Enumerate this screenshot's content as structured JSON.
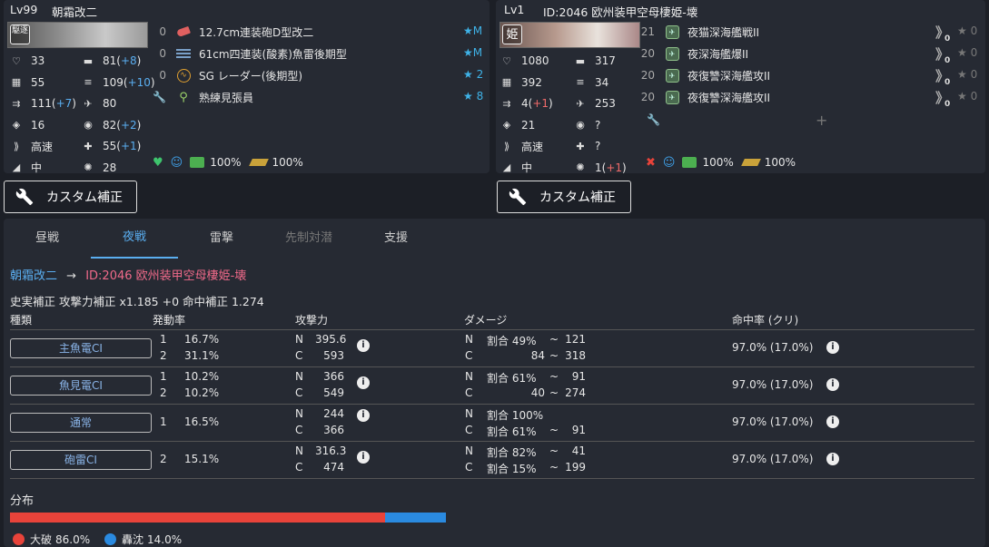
{
  "left_ship": {
    "level": "Lv99",
    "name": "朝霜改二",
    "banner_kanji": "駆逐",
    "stats": [
      {
        "icon": "heart-icon",
        "value": "33"
      },
      {
        "icon": "firepower-icon",
        "value": "81",
        "bonus": "+8"
      },
      {
        "icon": "armor-icon",
        "value": "55"
      },
      {
        "icon": "torpedo-icon",
        "value": "109",
        "bonus": "+10"
      },
      {
        "icon": "evasion-icon",
        "value": "111",
        "bonus": "+7"
      },
      {
        "icon": "aa-icon",
        "value": "80"
      },
      {
        "icon": "asw-icon",
        "value": "16"
      },
      {
        "icon": "los-icon",
        "value": "82",
        "bonus": "+2"
      },
      {
        "icon": "speed-icon",
        "value": "高速"
      },
      {
        "icon": "luck-icon",
        "value": "55",
        "bonus": "+1"
      },
      {
        "icon": "range-icon",
        "value": "中"
      },
      {
        "icon": "accuracy-icon",
        "value": "28"
      }
    ],
    "equipment": [
      {
        "slot": "0",
        "icon": "small-gun-icon",
        "name": "12.7cm連装砲D型改二",
        "level": "★M"
      },
      {
        "slot": "0",
        "icon": "torpedo-equip-icon",
        "name": "61cm四連装(酸素)魚雷後期型",
        "level": "★M"
      },
      {
        "slot": "0",
        "icon": "radar-icon",
        "name": "SG レーダー(後期型)",
        "level": "★ 2"
      },
      {
        "slot": "",
        "icon": "wrench-icon",
        "name": "熟練見張員",
        "level": "★ 8"
      }
    ],
    "status": {
      "condition": "100%",
      "ammo": "100%"
    }
  },
  "right_ship": {
    "level": "Lv1",
    "name": "ID:2046 欧州装甲空母棲姫-壊",
    "banner_kanji": "姫",
    "stats": [
      {
        "icon": "heart-icon",
        "value": "1080"
      },
      {
        "icon": "firepower-icon",
        "value": "317"
      },
      {
        "icon": "armor-icon",
        "value": "392"
      },
      {
        "icon": "torpedo-icon",
        "value": "34"
      },
      {
        "icon": "evasion-icon",
        "value": "4",
        "bonus": "+1",
        "bonus_neg": true
      },
      {
        "icon": "aa-icon",
        "value": "253"
      },
      {
        "icon": "asw-icon",
        "value": "21"
      },
      {
        "icon": "los-icon",
        "value": "?"
      },
      {
        "icon": "speed-icon",
        "value": "高速"
      },
      {
        "icon": "luck-icon",
        "value": "?"
      },
      {
        "icon": "range-icon",
        "value": "中"
      },
      {
        "icon": "accuracy-icon",
        "value": "1",
        "bonus": "+1",
        "bonus_neg": true
      }
    ],
    "equipment": [
      {
        "slot": "21",
        "name": "夜猫深海艦戦II",
        "prof": "0"
      },
      {
        "slot": "20",
        "name": "夜深海艦爆II",
        "prof": "0"
      },
      {
        "slot": "20",
        "name": "夜復讐深海艦攻II",
        "prof": "0"
      },
      {
        "slot": "20",
        "name": "夜復讐深海艦攻II",
        "prof": "0"
      }
    ],
    "extra_slot_plus": "+",
    "status": {
      "condition": "100%",
      "ammo": "100%"
    }
  },
  "custom_button_label": "カスタム補正",
  "tabs": [
    "昼戦",
    "夜戦",
    "雷撃",
    "先制対潜",
    "支援"
  ],
  "active_tab": 1,
  "route": {
    "attacker": "朝霜改二",
    "arrow": "→",
    "defender": "ID:2046 欧州装甲空母棲姫-壊"
  },
  "modifiers": "史実補正 攻撃力補正 x1.185 +0 命中補正 1.274",
  "table": {
    "headers": [
      "種類",
      "発動率",
      "攻撃力",
      "ダメージ",
      "命中率 (クリ)"
    ],
    "rows": [
      {
        "type": "主魚電CI",
        "rates": [
          [
            "1",
            "16.7%"
          ],
          [
            "2",
            "31.1%"
          ]
        ],
        "power": [
          [
            "N",
            "395.6"
          ],
          [
            "C",
            "593"
          ]
        ],
        "damage": [
          [
            "N",
            "割合 49%",
            "~",
            "121"
          ],
          [
            "C",
            "84",
            "~",
            "318"
          ]
        ],
        "hit": "97.0%  (17.0%)"
      },
      {
        "type": "魚見電CI",
        "rates": [
          [
            "1",
            "10.2%"
          ],
          [
            "2",
            "10.2%"
          ]
        ],
        "power": [
          [
            "N",
            "366"
          ],
          [
            "C",
            "549"
          ]
        ],
        "damage": [
          [
            "N",
            "割合 61%",
            "~",
            "91"
          ],
          [
            "C",
            "40",
            "~",
            "274"
          ]
        ],
        "hit": "97.0%  (17.0%)"
      },
      {
        "type": "通常",
        "rates": [
          [
            "1",
            "16.5%"
          ]
        ],
        "power": [
          [
            "N",
            "244"
          ],
          [
            "C",
            "366"
          ]
        ],
        "damage": [
          [
            "N",
            "割合 100%",
            "",
            ""
          ],
          [
            "C",
            "割合 61%",
            "~",
            "91"
          ]
        ],
        "hit": "97.0%  (17.0%)"
      },
      {
        "type": "砲雷CI",
        "rates": [
          [
            "2",
            "15.1%"
          ]
        ],
        "power": [
          [
            "N",
            "316.3"
          ],
          [
            "C",
            "474"
          ]
        ],
        "damage": [
          [
            "N",
            "割合 82%",
            "~",
            "41"
          ],
          [
            "C",
            "割合 15%",
            "~",
            "199"
          ]
        ],
        "hit": "97.0%  (17.0%)"
      }
    ]
  },
  "distribution": {
    "title": "分布",
    "segments": [
      {
        "label": "大破",
        "value": "86.0%",
        "fraction": 0.86,
        "color": "#e8433a"
      },
      {
        "label": "轟沈",
        "value": "14.0%",
        "fraction": 0.14,
        "color": "#2a8ae0"
      }
    ]
  }
}
